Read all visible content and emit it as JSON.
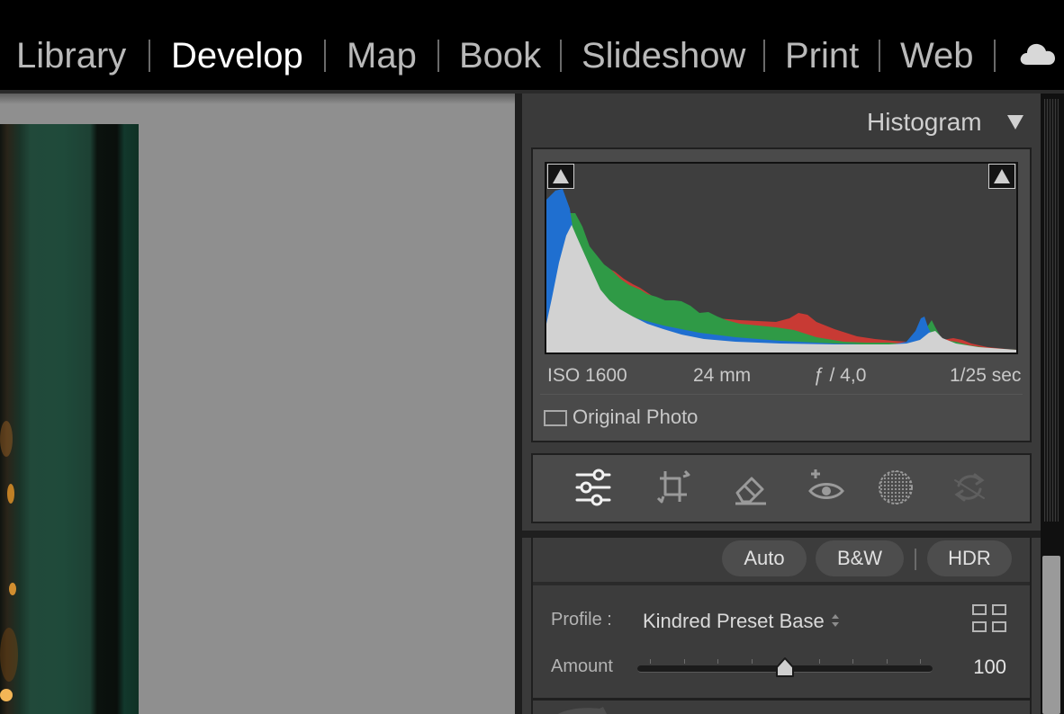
{
  "module_picker": {
    "modules": [
      {
        "label": "Library",
        "active": false
      },
      {
        "label": "Develop",
        "active": true
      },
      {
        "label": "Map",
        "active": false
      },
      {
        "label": "Book",
        "active": false
      },
      {
        "label": "Slideshow",
        "active": false
      },
      {
        "label": "Print",
        "active": false
      },
      {
        "label": "Web",
        "active": false
      }
    ],
    "cloud_icon": "cloud-icon"
  },
  "histogram": {
    "header": "Histogram",
    "collapse_icon": "triangle-down-icon",
    "shadow_clipping_icon": "triangle-up-icon",
    "highlight_clipping_icon": "triangle-up-icon",
    "exif": {
      "iso": "ISO 1600",
      "focal_length": "24 mm",
      "aperture": "ƒ / 4,0",
      "shutter": "1/25 sec"
    },
    "original_photo_label": "Original Photo",
    "original_photo_checked": false,
    "colors": {
      "red": "#c83a34",
      "green": "#2f9a46",
      "blue": "#1f6fd0",
      "luma": "#d2d2d2"
    }
  },
  "tool_strip": {
    "tools": [
      {
        "name": "edit-sliders-icon",
        "active": true
      },
      {
        "name": "crop-icon",
        "active": false
      },
      {
        "name": "healing-eraser-icon",
        "active": false
      },
      {
        "name": "red-eye-icon",
        "active": false
      },
      {
        "name": "masking-icon",
        "active": false
      },
      {
        "name": "update-refresh-icon",
        "active": false,
        "disabled": true
      }
    ]
  },
  "basic": {
    "buttons": {
      "auto": "Auto",
      "bw": "B&W",
      "hdr": "HDR"
    },
    "profile_label": "Profile :",
    "profile_value": "Kindred Preset Base",
    "profile_browser_icon": "grid-icon",
    "amount_label": "Amount",
    "amount_value": "100",
    "amount_fraction": 0.5
  }
}
